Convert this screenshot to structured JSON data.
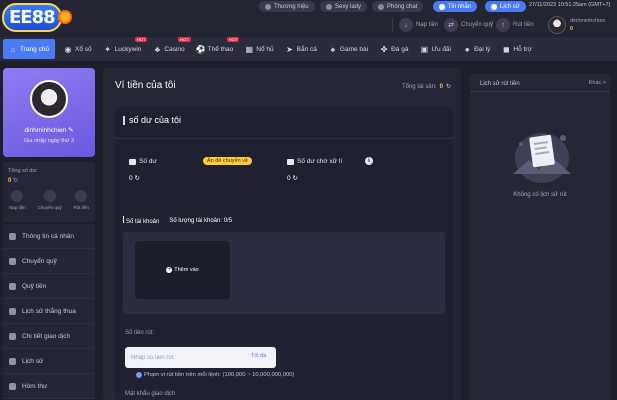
{
  "header": {
    "logo_text": "EE88",
    "top_buttons": [
      {
        "label": "Thương hiệu",
        "active": false
      },
      {
        "label": "Sexy lady",
        "active": false
      },
      {
        "label": "Phòng chat",
        "active": false
      },
      {
        "label": "Tin nhắn",
        "active": true
      },
      {
        "label": "Lịch sử",
        "active": true
      }
    ],
    "datetime": "27/11/2023 10:51:25am (GMT+7)",
    "deposit_label": "Nạp tiền",
    "transfer_label": "Chuyển quỹ",
    "withdraw_label": "Rút tiền",
    "username": "dinhminhchien",
    "balance": "0"
  },
  "nav": {
    "items": [
      {
        "label": "Trang chủ",
        "icon": "home-icon",
        "active": true,
        "hot": false
      },
      {
        "label": "Xổ số",
        "icon": "lottery-icon",
        "active": false,
        "hot": false
      },
      {
        "label": "Luckywin",
        "icon": "luckywin-icon",
        "active": false,
        "hot": true
      },
      {
        "label": "Casino",
        "icon": "casino-icon",
        "active": false,
        "hot": true
      },
      {
        "label": "Thể thao",
        "icon": "sports-icon",
        "active": false,
        "hot": true
      },
      {
        "label": "Nổ hũ",
        "icon": "slots-icon",
        "active": false,
        "hot": false
      },
      {
        "label": "Bắn cá",
        "icon": "fishing-icon",
        "active": false,
        "hot": false
      },
      {
        "label": "Game bài",
        "icon": "cards-icon",
        "active": false,
        "hot": false
      },
      {
        "label": "Đá gà",
        "icon": "cockfight-icon",
        "active": false,
        "hot": false
      },
      {
        "label": "Ưu đãi",
        "icon": "gift-icon",
        "active": false,
        "hot": false
      },
      {
        "label": "Đại lý",
        "icon": "agent-icon",
        "active": false,
        "hot": false
      },
      {
        "label": "Hỗ trợ",
        "icon": "support-icon",
        "active": false,
        "hot": false
      }
    ],
    "hot_badge": "HOT"
  },
  "sidebar": {
    "username": "dinhminhchien",
    "login_days": "Gia nhập ngày thứ 3",
    "total_balance_label": "Tổng số dư:",
    "total_balance_value": "0",
    "quick_actions": [
      "Nạp tiền",
      "Chuyển quỹ",
      "Rút tiền"
    ],
    "menu": [
      "Thông tin cá nhân",
      "Chuyển quỹ",
      "Quỹ tiền",
      "Lịch sử thắng thua",
      "Chi tiết giao dịch",
      "Lịch sử",
      "Hòm thư"
    ]
  },
  "main": {
    "title": "Ví tiền của tôi",
    "total_assets_label": "Tổng tài sản:",
    "total_assets_value": "0",
    "balance_section_title": "số dư của tôi",
    "balance_label": "Số dư",
    "hide_funds_label": "Ẩn đề chuyển về",
    "balance_value": "0",
    "pending_label": "Số dư chờ xử lí",
    "pending_value": "0",
    "account_section_title": "Số tài khoản",
    "account_count_label": "Số lượng tài khoản:",
    "account_count_value": "0/5",
    "add_card_label": "Thêm vào",
    "amount_label": "Số tiền rút:",
    "amount_placeholder": "Nhập số tiền rút",
    "max_label": "Tối đa",
    "range_note": "Phạm vi rút tiền trên mỗi lệnh: (100,000 ~ 10,000,000,000)",
    "password_label": "Mật khẩu giao dịch"
  },
  "history": {
    "title": "Lịch sử rút tiền",
    "other_label": "Khác >",
    "empty_text": "Không có lịch sử rút"
  },
  "colors": {
    "accent": "#4a7bf7",
    "gold": "#ffc233",
    "background": "#1d1f2b",
    "panel": "#252736"
  }
}
